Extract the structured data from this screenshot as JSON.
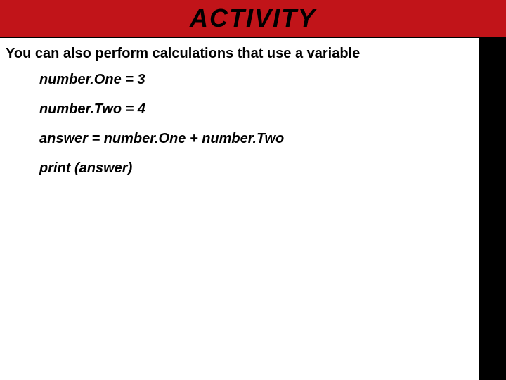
{
  "header": {
    "title": "ACTIVITY"
  },
  "intro": "You can also perform calculations that use a variable",
  "code": {
    "lines": [
      "number.One = 3",
      "number.Two = 4",
      "answer = number.One + number.Two",
      "print (answer)"
    ]
  }
}
